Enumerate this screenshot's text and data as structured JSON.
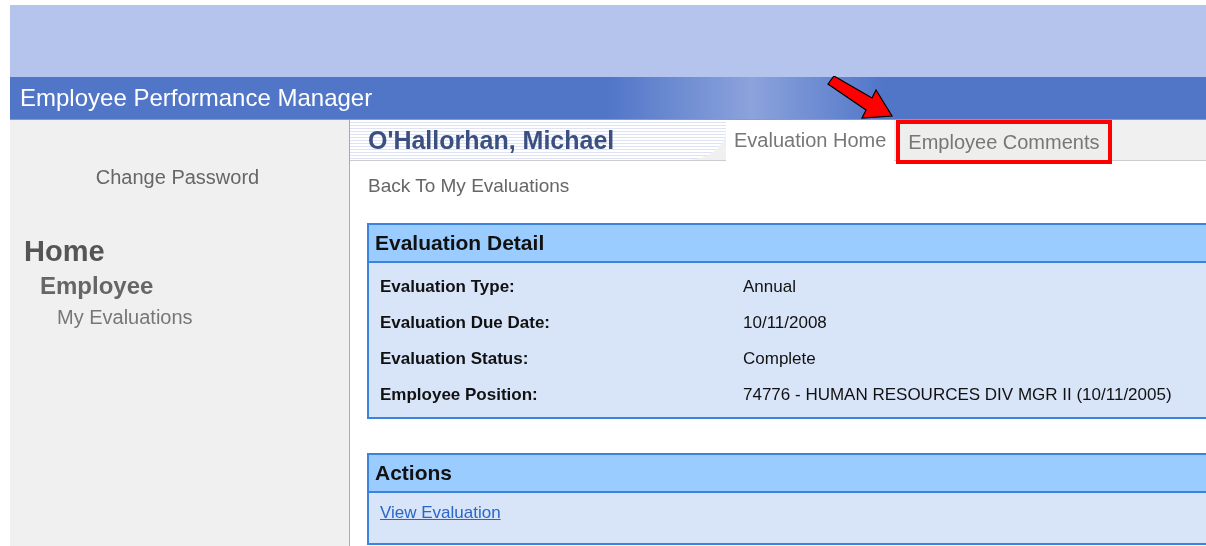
{
  "app_title": "Employee Performance Manager",
  "sidebar": {
    "change_password": "Change Password",
    "nav": [
      {
        "label": "Home",
        "children": [
          {
            "label": "Employee",
            "children": [
              {
                "label": "My Evaluations"
              }
            ]
          }
        ]
      }
    ]
  },
  "employee_name": "O'Hallorhan, Michael",
  "tabs": [
    {
      "label": "Evaluation Home",
      "selected": true,
      "highlighted": false
    },
    {
      "label": "Employee Comments",
      "selected": false,
      "highlighted": true
    }
  ],
  "back_link": "Back To My Evaluations",
  "evaluation_detail": {
    "title": "Evaluation Detail",
    "fields": [
      {
        "label": "Evaluation Type:",
        "value": "Annual"
      },
      {
        "label": "Evaluation Due Date:",
        "value": "10/11/2008"
      },
      {
        "label": "Evaluation Status:",
        "value": "Complete"
      },
      {
        "label": "Employee Position:",
        "value": "74776 - HUMAN RESOURCES DIV MGR II (10/11/2005)"
      }
    ]
  },
  "actions": {
    "title": "Actions",
    "links": [
      "View Evaluation"
    ]
  }
}
